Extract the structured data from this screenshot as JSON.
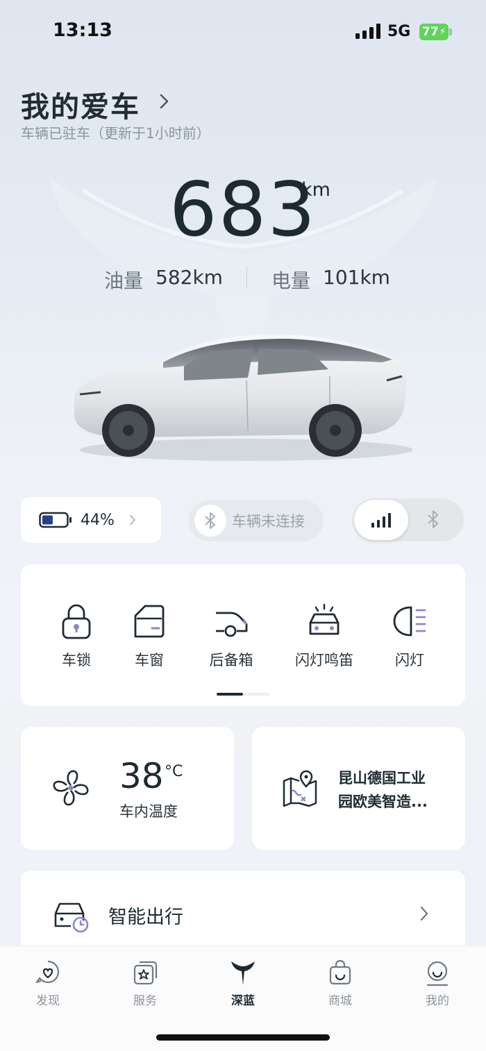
{
  "status_bar": {
    "time": "13:13",
    "network": "5G",
    "battery": "77"
  },
  "header": {
    "title": "我的爱车",
    "subtitle": "车辆已驻车（更新于1小时前）"
  },
  "range": {
    "value": "683",
    "unit": "km",
    "fuel_label": "油量",
    "fuel_value": "582km",
    "electric_label": "电量",
    "electric_value": "101km"
  },
  "battery_card": {
    "percent": "44%",
    "level": 0.44
  },
  "connection": {
    "status": "车辆未连接"
  },
  "controls": {
    "items": [
      {
        "label": "车锁",
        "icon": "lock-icon"
      },
      {
        "label": "车窗",
        "icon": "window-icon"
      },
      {
        "label": "后备箱",
        "icon": "trunk-icon"
      },
      {
        "label": "闪灯鸣笛",
        "icon": "flash-horn-icon"
      },
      {
        "label": "闪灯",
        "icon": "headlight-icon"
      }
    ],
    "page": 1,
    "page_count": 2
  },
  "temperature": {
    "value": "38",
    "unit": "°C",
    "label": "车内温度"
  },
  "location": {
    "line1": "昆山德国工业",
    "line2": "园欧美智造..."
  },
  "smart_travel": {
    "label": "智能出行"
  },
  "tabs": [
    {
      "label": "发现",
      "icon": "discover-icon"
    },
    {
      "label": "服务",
      "icon": "service-icon"
    },
    {
      "label": "深蓝",
      "icon": "deepal-logo-icon",
      "active": true
    },
    {
      "label": "商城",
      "icon": "shop-bag-icon"
    },
    {
      "label": "我的",
      "icon": "profile-icon"
    }
  ],
  "colors": {
    "accent": "#1e2a33",
    "icon_purple": "#8d86c9",
    "battery_green": "#5fd35a"
  }
}
